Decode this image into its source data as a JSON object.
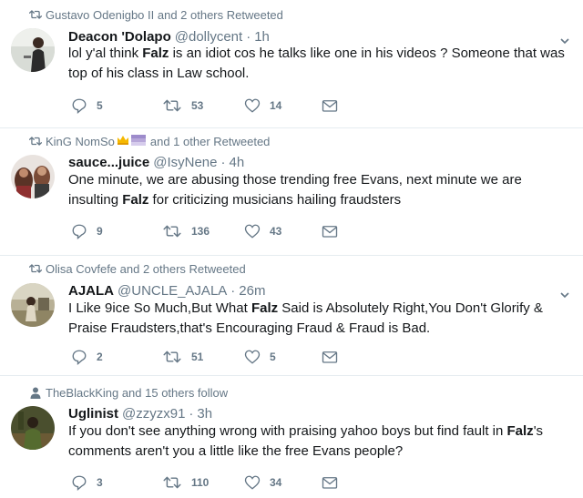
{
  "tweets": [
    {
      "social_context": "Gustavo Odenigbo II and 2 others Retweeted",
      "name": "Deacon 'Dolapo",
      "handle": "@dollycent",
      "separator": "·",
      "time": "1h",
      "text_parts": [
        "lol y'al think ",
        "Falz",
        " is an idiot cos he talks like one in his videos ? Someone that was top of his class in Law school."
      ],
      "replies": "5",
      "retweets": "53",
      "likes": "14"
    },
    {
      "social_context_name": "KinG NomSo",
      "social_context_rest": "and 1 other Retweeted",
      "name": "sauce...juice",
      "handle": "@IsyNene",
      "separator": "·",
      "time": "4h",
      "text_parts": [
        "One minute, we are abusing those trending free Evans, next minute we are insulting ",
        "Falz",
        " for criticizing musicians hailing fraudsters"
      ],
      "replies": "9",
      "retweets": "136",
      "likes": "43"
    },
    {
      "social_context": "Olisa Covfefe and 2 others Retweeted",
      "name": "AJALA",
      "handle": "@UNCLE_AJALA",
      "separator": "·",
      "time": "26m",
      "text_parts": [
        "I Like 9ice So Much,But What ",
        "Falz",
        " Said is Absolutely Right,You Don't Glorify & Praise Fraudsters,that's Encouraging Fraud & Fraud is Bad."
      ],
      "replies": "2",
      "retweets": "51",
      "likes": "5"
    },
    {
      "social_context": "TheBlackKing and 15 others follow",
      "name": "Uglinist",
      "handle": "@zzyzx91",
      "separator": "·",
      "time": "3h",
      "text_parts": [
        "If you don't see anything wrong with praising yahoo boys but find fault in ",
        "Falz",
        "'s comments aren't you a little like the free Evans people?"
      ],
      "replies": "3",
      "retweets": "110",
      "likes": "34"
    }
  ],
  "icons": {
    "retweet": "retweet-icon",
    "follow": "person-icon",
    "reply": "reply-icon",
    "like": "heart-icon",
    "dm": "envelope-icon",
    "more": "chevron-down-icon"
  },
  "colors": {
    "secondary_text": "#657786",
    "primary_text": "#14171a",
    "divider": "#e6ecf0"
  }
}
